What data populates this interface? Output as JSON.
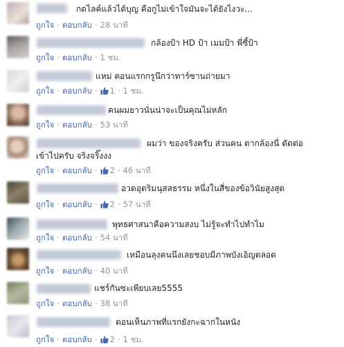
{
  "labels": {
    "like": "ถูกใจ",
    "reply": "ตอบกลับ"
  },
  "comments": [
    {
      "text": "กดไลค์แล้วได้บุญ คือกูไม่เข้าใจมันจะได้ยังไงวะ...",
      "likes": "",
      "time": "28 นาที"
    },
    {
      "text": "กล้องป้า HD ป้า เมมป้า พี่ซี้ป้า",
      "likes": "",
      "time": "1 ชม."
    },
    {
      "text": "แหม่ ตอนแรกกรูนึกว่าทาร์ซานถ่ายมา",
      "likes": "1",
      "time": "1 ชม."
    },
    {
      "text": "คนผมยาวนั่นน่าจะเป็นคุณไม่หลัก",
      "likes": "",
      "time": "53 นาที"
    },
    {
      "text": "ผมว่า ของจริงครับ ส่วนคน ตากล้องนี่ ตัดต่อ",
      "text2": "เข้าไปครับ จริงจริ๊งงง",
      "likes": "2",
      "time": "46 นาที"
    },
    {
      "text": "อวดอุตริมนุสสธรรม หนึ่งในสี่ของข้อวินัยสูงสุด",
      "likes": "2",
      "time": "57 นาที"
    },
    {
      "text": "พุทธศาสนาคือความสงบ ไม่รู้จะทำไปทำไม",
      "likes": "",
      "time": "54 นาที"
    },
    {
      "text": "เหมือนลุงคนนึงเลยชอบมีภาพบังเอิญตลอด",
      "likes": "",
      "time": "40 นาที"
    },
    {
      "text": "แชร์กันซะเพียบเลย5555",
      "likes": "",
      "time": "38 นาที"
    },
    {
      "text": "ตอนเห็นภาพที่แรกยังกะฉากในหนัง",
      "likes": "2",
      "time": "1 ชม."
    }
  ]
}
